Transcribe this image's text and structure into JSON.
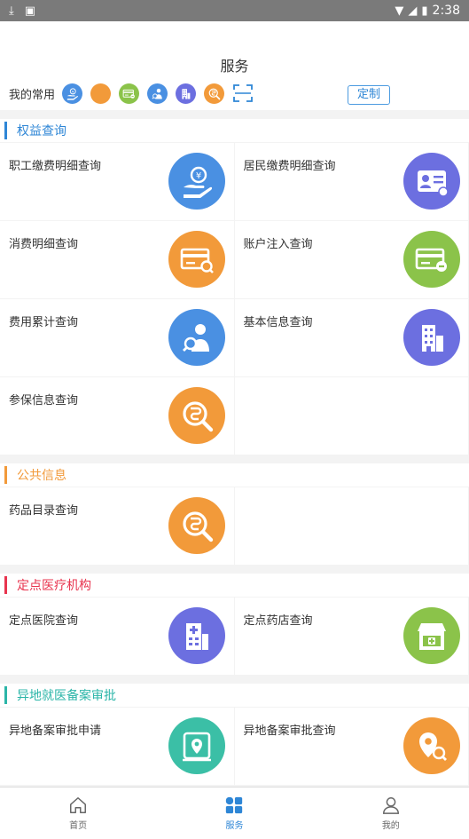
{
  "status_bar": {
    "time": "2:38",
    "icons": [
      "download-icon",
      "image-icon",
      "wifi-icon",
      "signal-icon",
      "battery-icon"
    ]
  },
  "header": {
    "title": "服务"
  },
  "favorites": {
    "label": "我的常用",
    "icons": [
      {
        "name": "hand-coin-icon",
        "color": "#4a90e2"
      },
      {
        "name": "card-icon",
        "color": "#f29a3a"
      },
      {
        "name": "card-plus-icon",
        "color": "#8bc34a"
      },
      {
        "name": "user-search-icon",
        "color": "#4a90e2"
      },
      {
        "name": "building-icon",
        "color": "#6c6fe0"
      },
      {
        "name": "magnifier-icon",
        "color": "#f29a3a"
      }
    ],
    "customize_label": "定制"
  },
  "sections": [
    {
      "title": "权益查询",
      "color": "#2e86d6",
      "items": [
        {
          "label": "职工缴费明细查询",
          "icon": "hand-coin-icon",
          "color": "#4a90e2"
        },
        {
          "label": "居民缴费明细查询",
          "icon": "id-card-icon",
          "color": "#6c6fe0"
        },
        {
          "label": "消费明细查询",
          "icon": "card-search-icon",
          "color": "#f29a3a"
        },
        {
          "label": "账户注入查询",
          "icon": "card-plus-icon",
          "color": "#8bc34a"
        },
        {
          "label": "费用累计查询",
          "icon": "user-search-icon",
          "color": "#4a90e2"
        },
        {
          "label": "基本信息查询",
          "icon": "building-icon",
          "color": "#6c6fe0"
        },
        {
          "label": "参保信息查询",
          "icon": "magnifier-icon",
          "color": "#f29a3a"
        }
      ]
    },
    {
      "title": "公共信息",
      "color": "#f29a3a",
      "items": [
        {
          "label": "药品目录查询",
          "icon": "magnifier-icon",
          "color": "#f29a3a"
        }
      ]
    },
    {
      "title": "定点医疗机构",
      "color": "#e8344e",
      "items": [
        {
          "label": "定点医院查询",
          "icon": "hospital-icon",
          "color": "#6c6fe0"
        },
        {
          "label": "定点药店查询",
          "icon": "pharmacy-icon",
          "color": "#8bc34a"
        }
      ]
    },
    {
      "title": "异地就医备案审批",
      "color": "#2bb5a8",
      "items": [
        {
          "label": "异地备案审批申请",
          "icon": "map-pin-icon",
          "color": "#3bbfa6"
        },
        {
          "label": "异地备案审批查询",
          "icon": "map-search-icon",
          "color": "#f29a3a"
        }
      ]
    }
  ],
  "tabbar": {
    "tabs": [
      {
        "label": "首页",
        "icon": "home-icon",
        "active": false
      },
      {
        "label": "服务",
        "icon": "grid-icon",
        "active": true
      },
      {
        "label": "我的",
        "icon": "user-icon",
        "active": false
      }
    ]
  }
}
